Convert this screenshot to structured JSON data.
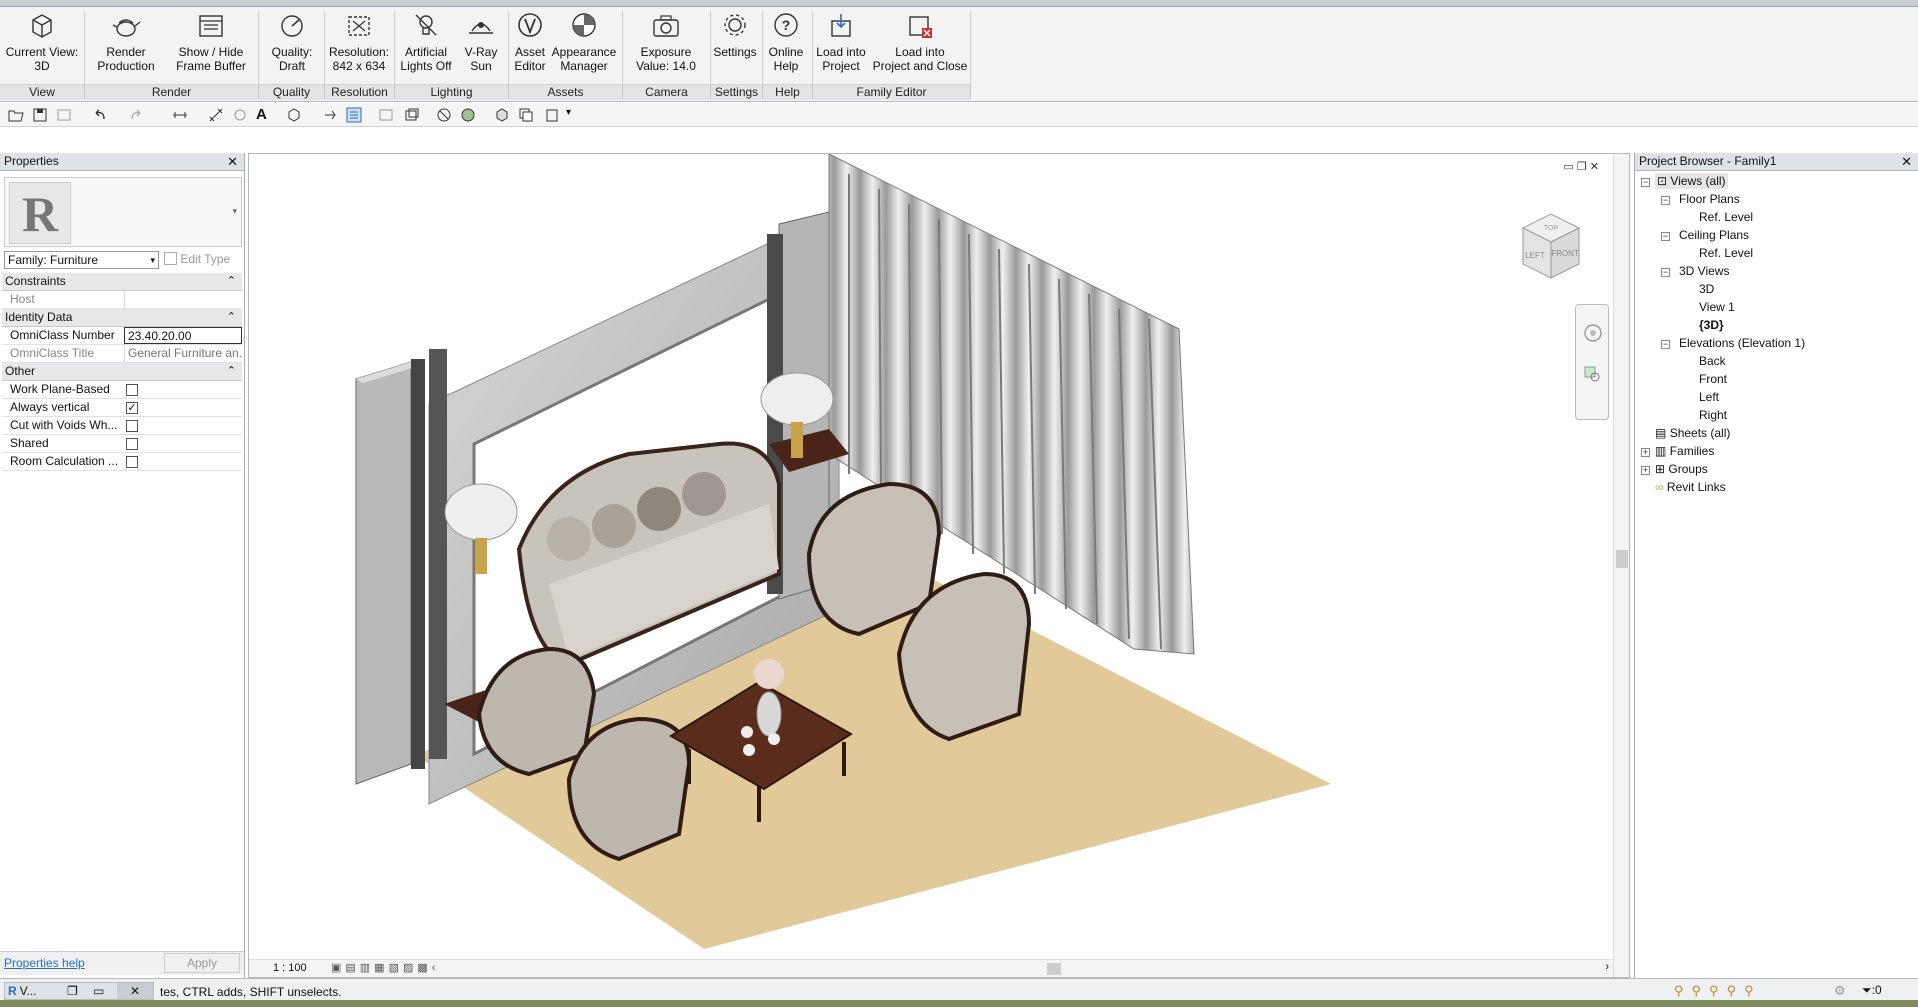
{
  "ribbon": {
    "buttons": [
      {
        "label": "Current View:",
        "label2": "3D"
      },
      {
        "label": "Render",
        "label2": "Production"
      },
      {
        "label": "Show / Hide",
        "label2": "Frame Buffer"
      },
      {
        "label": "Quality:",
        "label2": "Draft"
      },
      {
        "label": "Resolution:",
        "label2": "842 x 634"
      },
      {
        "label": "Artificial",
        "label2": "Lights Off"
      },
      {
        "label": "V-Ray",
        "label2": "Sun"
      },
      {
        "label": "Asset",
        "label2": "Editor"
      },
      {
        "label": "Appearance",
        "label2": "Manager"
      },
      {
        "label": "Exposure",
        "label2": "Value: 14.0"
      },
      {
        "label": "Settings",
        "label2": ""
      },
      {
        "label": "Online",
        "label2": "Help"
      },
      {
        "label": "Load into",
        "label2": "Project"
      },
      {
        "label": "Load into",
        "label2": "Project and Close"
      }
    ],
    "groups": [
      "View",
      "Render",
      "Quality",
      "Resolution",
      "Lighting",
      "Assets",
      "Camera",
      "Settings",
      "Help",
      "Family Editor"
    ]
  },
  "properties": {
    "title": "Properties",
    "type_selector": "Family: Furniture",
    "edit_type": "Edit Type",
    "groups": {
      "constraints": "Constraints",
      "identity": "Identity Data",
      "other": "Other"
    },
    "rows": {
      "host": {
        "key": "Host",
        "value": ""
      },
      "omniclass_number": {
        "key": "OmniClass Number",
        "value": "23.40.20.00"
      },
      "omniclass_title": {
        "key": "OmniClass Title",
        "value": "General Furniture an..."
      },
      "work_plane": {
        "key": "Work Plane-Based",
        "checked": false
      },
      "always_vertical": {
        "key": "Always vertical",
        "checked": true
      },
      "cut_voids": {
        "key": "Cut with Voids Wh...",
        "checked": false
      },
      "shared": {
        "key": "Shared",
        "checked": false
      },
      "room_calc": {
        "key": "Room Calculation ...",
        "checked": false
      }
    },
    "help_link": "Properties help",
    "apply": "Apply"
  },
  "view": {
    "scale": "1 : 100",
    "viewcube_top": "TOP",
    "viewcube_left": "LEFT",
    "viewcube_front": "FRONT"
  },
  "browser": {
    "title": "Project Browser - Family1",
    "nodes": {
      "views_all": "Views (all)",
      "floor_plans": "Floor Plans",
      "fp_ref": "Ref. Level",
      "ceiling_plans": "Ceiling Plans",
      "cp_ref": "Ref. Level",
      "views_3d": "3D Views",
      "v3d": "3D",
      "view1": "View 1",
      "v3d_cur": "{3D}",
      "elevations": "Elevations (Elevation 1)",
      "back": "Back",
      "front": "Front",
      "left": "Left",
      "right": "Right",
      "sheets": "Sheets (all)",
      "families": "Families",
      "groups": "Groups",
      "revit_links": "Revit Links"
    }
  },
  "status": {
    "text": "tes, CTRL adds, SHIFT unselects.",
    "tab_label": "V...",
    "filter_count": ":0"
  },
  "colors": {
    "floor": "#e2c99a",
    "accent": "#2a6ebb"
  }
}
